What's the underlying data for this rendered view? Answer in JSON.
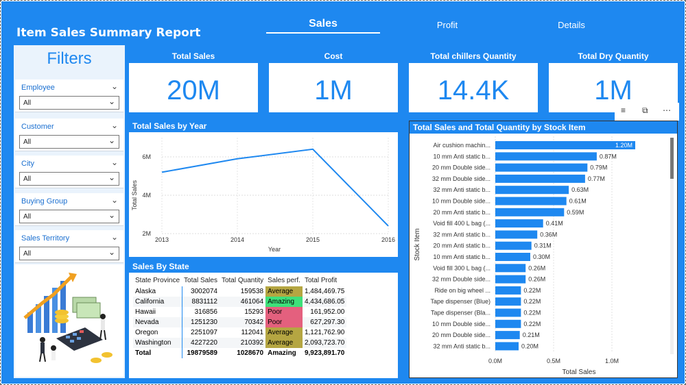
{
  "app": {
    "title": "Item Sales Summary Report"
  },
  "tabs": [
    {
      "label": "Sales",
      "active": true
    },
    {
      "label": "Profit",
      "active": false
    },
    {
      "label": "Details",
      "active": false
    }
  ],
  "filters": {
    "title": "Filters",
    "slicers": [
      {
        "label": "Employee",
        "value": "All"
      },
      {
        "label": "Customer",
        "value": "All"
      },
      {
        "label": "City",
        "value": "All"
      },
      {
        "label": "Buying Group",
        "value": "All"
      },
      {
        "label": "Sales Territory",
        "value": "All"
      }
    ]
  },
  "kpis": [
    {
      "label": "Total Sales",
      "value": "20M"
    },
    {
      "label": "Cost",
      "value": "1M"
    },
    {
      "label": "Total chillers Quantity",
      "value": "14.4K"
    },
    {
      "label": "Total Dry Quantity",
      "value": "1M"
    }
  ],
  "line_chart": {
    "title": "Total Sales by Year",
    "ylabel": "Total Sales",
    "xlabel": "Year",
    "y_ticks": [
      "2M",
      "4M",
      "6M"
    ],
    "x_ticks": [
      "2013",
      "2014",
      "2015",
      "2016"
    ]
  },
  "bar_chart": {
    "title": "Total Sales and Total Quantity by Stock Item",
    "ylabel": "Stock Item",
    "xlabel": "Total Sales",
    "x_ticks": [
      "0.0M",
      "0.5M",
      "1.0M"
    ]
  },
  "state_table": {
    "title": "Sales By State",
    "headers": [
      "State Province",
      "Total Sales",
      "Total Quantity",
      "Sales perf.",
      "Total Profit"
    ],
    "rows": [
      [
        "Alaska",
        "3002074",
        "159538",
        "Average",
        "1,484,469.75"
      ],
      [
        "California",
        "8831112",
        "461064",
        "Amazing",
        "4,434,686.05"
      ],
      [
        "Hawaii",
        "316856",
        "15293",
        "Poor",
        "161,952.00"
      ],
      [
        "Nevada",
        "1251230",
        "70342",
        "Poor",
        "627,297.30"
      ],
      [
        "Oregon",
        "2251097",
        "112041",
        "Average",
        "1,121,762.90"
      ],
      [
        "Washington",
        "4227220",
        "210392",
        "Average",
        "2,093,723.70"
      ]
    ],
    "total": [
      "Total",
      "19879589",
      "1028670",
      "Amazing",
      "9,923,891.70"
    ]
  },
  "perf_colors": {
    "Average": "#b5a642",
    "Amazing": "#3ee07a",
    "Poor": "#e4607e"
  },
  "colors": {
    "accent": "#1e88f0",
    "bar": "#1e88f0"
  },
  "icons": {
    "filter": "filter-icon",
    "focus": "focus-mode-icon",
    "more": "more-options-icon"
  },
  "chart_data": [
    {
      "type": "line",
      "title": "Total Sales by Year",
      "xlabel": "Year",
      "ylabel": "Total Sales",
      "x": [
        2013,
        2014,
        2015,
        2016
      ],
      "series": [
        {
          "values": [
            5200000,
            5900000,
            6400000,
            2400000
          ]
        }
      ],
      "ylim": [
        2000000,
        7000000
      ]
    },
    {
      "type": "bar",
      "orientation": "horizontal",
      "title": "Total Sales and Total Quantity by Stock Item",
      "xlabel": "Total Sales",
      "ylabel": "Stock Item",
      "categories": [
        "Air cushion machin...",
        "10 mm Anti static b...",
        "20 mm Double side...",
        "32 mm Double side...",
        "32 mm Anti static b...",
        "10 mm Double side...",
        "20 mm Anti static b...",
        "Void fill 400 L bag (...",
        "32 mm Anti static b...",
        "20 mm Anti static b...",
        "10 mm Anti static b...",
        "Void fill 300 L bag (...",
        "32 mm Double side...",
        "Ride on big wheel ...",
        "Tape dispenser (Blue)",
        "Tape dispenser (Bla...",
        "10 mm Double side...",
        "20 mm Double side...",
        "32 mm Anti static b..."
      ],
      "values": [
        1.2,
        0.87,
        0.79,
        0.77,
        0.63,
        0.61,
        0.59,
        0.41,
        0.36,
        0.31,
        0.3,
        0.26,
        0.26,
        0.22,
        0.22,
        0.22,
        0.22,
        0.21,
        0.2
      ],
      "labels": [
        "1.20M",
        "0.87M",
        "0.79M",
        "0.77M",
        "0.63M",
        "0.61M",
        "0.59M",
        "0.41M",
        "0.36M",
        "0.31M",
        "0.30M",
        "0.26M",
        "0.26M",
        "0.22M",
        "0.22M",
        "0.22M",
        "0.22M",
        "0.21M",
        "0.20M"
      ],
      "xlim": [
        0,
        1.3
      ]
    }
  ]
}
